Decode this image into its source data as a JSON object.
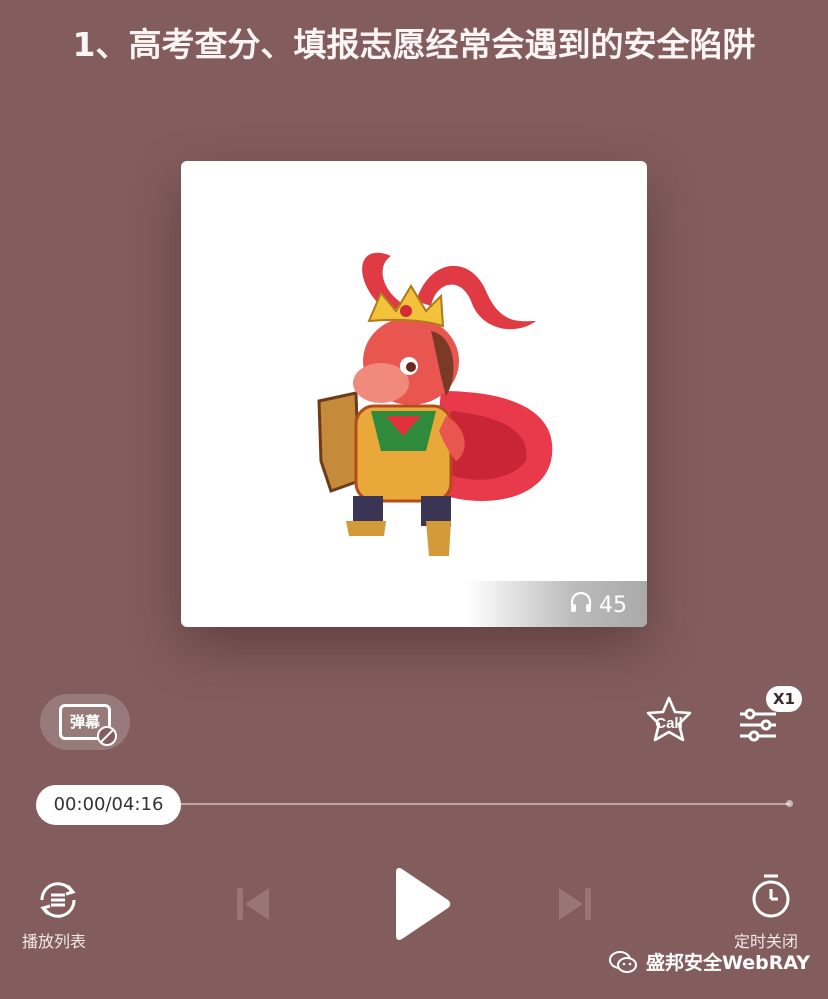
{
  "episode": {
    "title": "1、高考查分、填报志愿经常会遇到的安全陷阱",
    "listen_count": "45"
  },
  "toolbar": {
    "danmu_label": "弹幕",
    "call_label": "Call",
    "speed_badge": "X1"
  },
  "progress": {
    "time_text": "00:00/04:16",
    "played_fraction": 0
  },
  "controls": {
    "playlist_label": "播放列表",
    "timer_label": "定时关闭"
  },
  "watermark": {
    "text": "盛邦安全WebRAY"
  },
  "colors": {
    "background": "#835d5d",
    "accent": "#ffffff"
  },
  "icons": [
    "headphones-icon",
    "call-star-icon",
    "equalizer-icon",
    "playlist-icon",
    "previous-icon",
    "play-icon",
    "next-icon",
    "timer-icon",
    "wechat-icon"
  ]
}
